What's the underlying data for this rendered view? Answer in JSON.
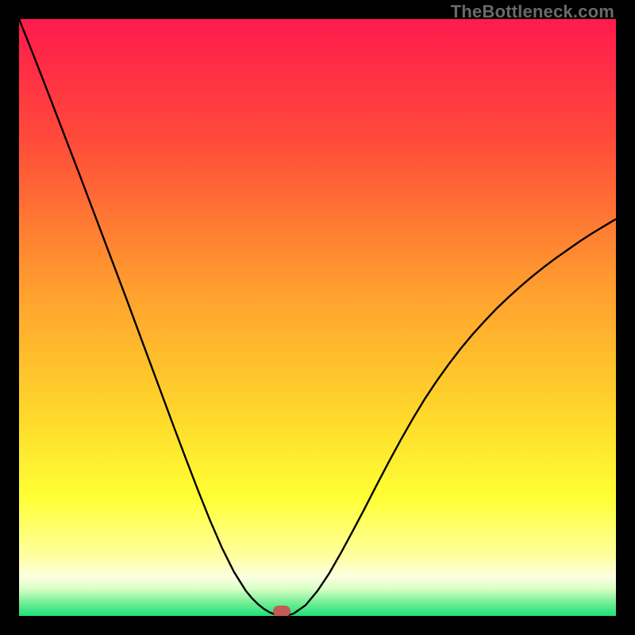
{
  "watermark": "TheBottleneck.com",
  "chart_data": {
    "type": "line",
    "title": "",
    "xlabel": "",
    "ylabel": "",
    "xlim": [
      0,
      100
    ],
    "ylim": [
      0,
      100
    ],
    "x": [
      0,
      2,
      4,
      6,
      8,
      10,
      12,
      14,
      16,
      18,
      20,
      22,
      24,
      26,
      28,
      30,
      32,
      34,
      36,
      38,
      39,
      40,
      41,
      42,
      43,
      44,
      45,
      46,
      48,
      50,
      52,
      54,
      56,
      58,
      60,
      62,
      64,
      66,
      68,
      70,
      72,
      74,
      76,
      78,
      80,
      82,
      84,
      86,
      88,
      90,
      92,
      94,
      96,
      98,
      100
    ],
    "y": [
      100,
      95,
      89.9,
      84.7,
      79.5,
      74.3,
      69.0,
      63.7,
      58.4,
      53.1,
      47.7,
      42.3,
      36.9,
      31.5,
      26.2,
      21.0,
      16.0,
      11.4,
      7.4,
      4.2,
      3.0,
      2.0,
      1.2,
      0.6,
      0.2,
      0.0,
      0.1,
      0.4,
      1.8,
      4.2,
      7.2,
      10.7,
      14.4,
      18.2,
      22.1,
      25.9,
      29.6,
      33.1,
      36.4,
      39.4,
      42.2,
      44.8,
      47.2,
      49.4,
      51.5,
      53.4,
      55.2,
      56.9,
      58.5,
      60.0,
      61.4,
      62.8,
      64.1,
      65.3,
      66.5
    ],
    "optimal_x": 44,
    "optimal_y": 0
  },
  "gradient_stops": [
    {
      "offset": 0,
      "color": "#ff1a4d"
    },
    {
      "offset": 0.2,
      "color": "#ff4a3a"
    },
    {
      "offset": 0.45,
      "color": "#ff9e2e"
    },
    {
      "offset": 0.65,
      "color": "#ffd42b"
    },
    {
      "offset": 0.8,
      "color": "#ffff33"
    },
    {
      "offset": 0.9,
      "color": "#ffffa0"
    },
    {
      "offset": 0.935,
      "color": "#fbffe2"
    },
    {
      "offset": 0.955,
      "color": "#d8ffc4"
    },
    {
      "offset": 0.975,
      "color": "#7ef09a"
    },
    {
      "offset": 1.0,
      "color": "#1ee077"
    }
  ],
  "marker_color": "#c45a53"
}
